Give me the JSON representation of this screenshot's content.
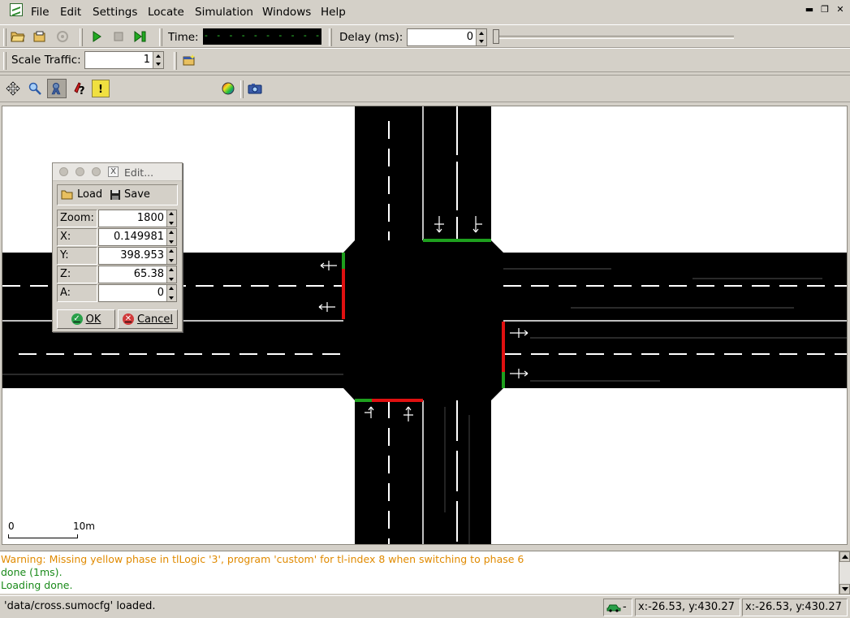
{
  "menubar": {
    "items": [
      {
        "label": "File"
      },
      {
        "label": "Edit"
      },
      {
        "label": "Settings"
      },
      {
        "label": "Locate"
      },
      {
        "label": "Simulation"
      },
      {
        "label": "Windows"
      },
      {
        "label": "Help"
      }
    ]
  },
  "toolbar": {
    "time_label": "Time:",
    "time_value": "- - - - - - - - - - - - - - - - -",
    "delay_label": "Delay (ms):",
    "delay_value": "0",
    "scale_traffic_label": "Scale Traffic:",
    "scale_traffic_value": "1",
    "scheme_value": "standard"
  },
  "canvas": {
    "scale_start": "0",
    "scale_end": "10m"
  },
  "edit_dialog": {
    "title": "Edit...",
    "load_label": "Load",
    "save_label": "Save",
    "fields": [
      {
        "label": "Zoom:",
        "value": "1800"
      },
      {
        "label": "X:",
        "value": "0.149981"
      },
      {
        "label": "Y:",
        "value": "398.953"
      },
      {
        "label": "Z:",
        "value": "65.38"
      },
      {
        "label": "A:",
        "value": "0"
      }
    ],
    "ok_label": "OK",
    "cancel_label": "Cancel"
  },
  "log": {
    "lines": [
      {
        "text": "Warning: Missing yellow phase in tlLogic '3', program 'custom' for tl-index 8 when switching to phase 6",
        "kind": "warning"
      },
      {
        "text": "done (1ms).",
        "kind": "ok"
      },
      {
        "text": "Loading done.",
        "kind": "ok"
      }
    ]
  },
  "statusbar": {
    "message": "'data/cross.sumocfg' loaded.",
    "vehicle_cell": "-",
    "coords_1": "x:-26.53, y:430.27",
    "coords_2": "x:-26.53, y:430.27"
  },
  "colors": {
    "road": "#000000",
    "signal_green": "#1ea01e",
    "signal_red": "#e01010",
    "warning_text": "#e08a00",
    "ok_text": "#1a8a1a"
  }
}
